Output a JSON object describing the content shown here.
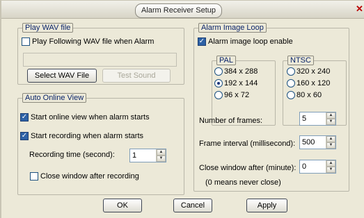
{
  "window": {
    "title": "Alarm Receiver Setup",
    "close_glyph": "✕"
  },
  "play_wav": {
    "legend": "Play WAV file",
    "checkbox_label": "Play Following WAV file when Alarm",
    "checked": false,
    "file_path": "",
    "select_button": "Select WAV File",
    "test_button": "Test Sound"
  },
  "online_view": {
    "legend": "Auto Online View",
    "start_view_label": "Start online view when alarm starts",
    "start_view_checked": true,
    "start_recording_label": "Start recording when alarm starts",
    "start_recording_checked": true,
    "recording_time_label": "Recording time (second):",
    "recording_time_value": "1",
    "close_window_label": "Close window after recording",
    "close_window_checked": false
  },
  "image_loop": {
    "legend": "Alarm Image Loop",
    "enable_label": "Alarm image loop enable",
    "enable_checked": true,
    "pal": {
      "legend": "PAL",
      "options": [
        "384 x 288",
        "192 x 144",
        "96 x 72"
      ],
      "selected": 1
    },
    "ntsc": {
      "legend": "NTSC",
      "options": [
        "320 x 240",
        "160 x 120",
        "80 x 60"
      ],
      "selected": -1
    },
    "frames_label": "Number of frames:",
    "frames_value": "5",
    "interval_label": "Frame interval (millisecond):",
    "interval_value": "500",
    "close_after_label": "Close window after (minute):",
    "close_after_value": "0",
    "close_note": "(0 means never close)"
  },
  "buttons": {
    "ok": "OK",
    "cancel": "Cancel",
    "apply": "Apply"
  },
  "check_glyph": "✓"
}
